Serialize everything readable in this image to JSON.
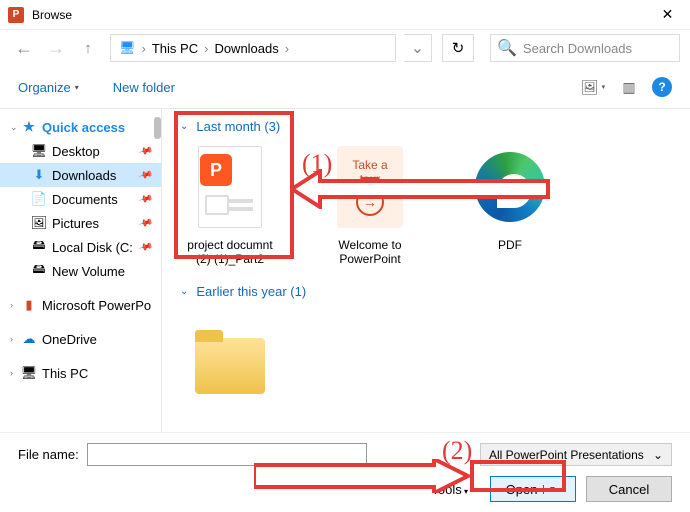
{
  "title": "Browse",
  "path": {
    "root": "This PC",
    "folder": "Downloads"
  },
  "search": {
    "placeholder": "Search Downloads"
  },
  "toolbar": {
    "organize": "Organize",
    "newfolder": "New folder"
  },
  "sidebar": {
    "quick": "Quick access",
    "items": [
      {
        "label": "Desktop",
        "icon": "🖥"
      },
      {
        "label": "Downloads",
        "icon": "⬇"
      },
      {
        "label": "Documents",
        "icon": "📄"
      },
      {
        "label": "Pictures",
        "icon": "🖼"
      },
      {
        "label": "Local Disk (C:",
        "icon": "🖴"
      },
      {
        "label": "New Volume",
        "icon": "🖴"
      }
    ],
    "mspp": "Microsoft PowerPo",
    "onedrive": "OneDrive",
    "thispc": "This PC"
  },
  "groups": {
    "g1": {
      "title": "Last month (3)"
    },
    "g2": {
      "title": "Earlier this year (1)"
    }
  },
  "files": {
    "f1": {
      "name": "project documnt",
      "sub": "(2) (1)_Part2"
    },
    "f2": {
      "name": "Welcome to PowerPoint",
      "tour1": "Take a",
      "tour2": "tour"
    },
    "f3": {
      "name": "PDF"
    }
  },
  "footer": {
    "fnlabel": "File name:",
    "filter": "All PowerPoint Presentations",
    "tools": "Tools",
    "open": "Open",
    "cancel": "Cancel"
  },
  "annot": {
    "a1": "(1)",
    "a2": "(2)"
  }
}
